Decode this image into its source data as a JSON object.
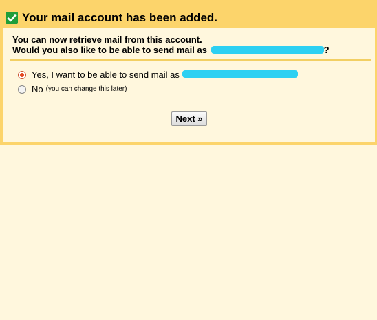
{
  "header": {
    "title": "Your mail account has been added."
  },
  "body": {
    "line1": "You can now retrieve mail from this account.",
    "line2_prefix": "Would you also like to be able to send mail as",
    "line2_suffix": "?"
  },
  "options": [
    {
      "label": "Yes, I want to be able to send mail as",
      "hint": "",
      "selected": true
    },
    {
      "label": "No",
      "hint": "(you can change this later)",
      "selected": false
    }
  ],
  "next_button": {
    "label": "Next »"
  },
  "colors": {
    "frame": "#fcd46b",
    "panel": "#fff7dd",
    "check": "#1f9e3a",
    "redaction": "#2dd0f2",
    "radio_selected": "#e4481f"
  },
  "icons": {
    "header": "check-icon"
  }
}
